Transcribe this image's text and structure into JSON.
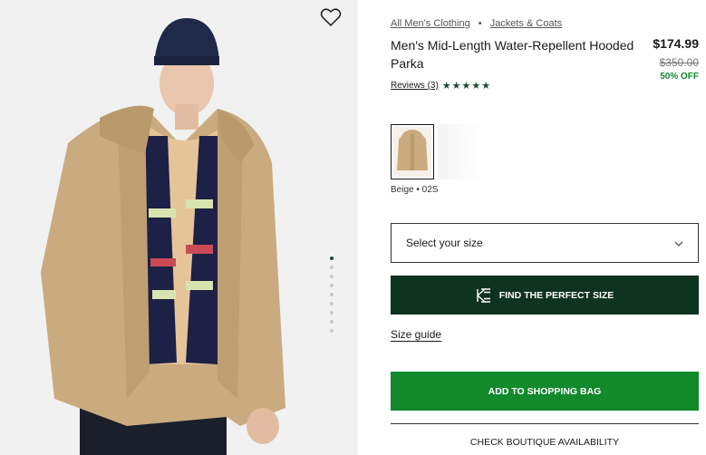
{
  "gallery": {
    "image_alt": "Model wearing beige mid-length hooded parka",
    "dot_count": 9,
    "active_dot": 0
  },
  "icons": {
    "wishlist": "heart-outline-icon",
    "stars": "star-icon",
    "chevron": "chevron-down-icon",
    "measure": "measure-logo-icon"
  },
  "product": {
    "breadcrumb": [
      "All Men's Clothing",
      "Jackets & Coats"
    ],
    "breadcrumb_separator": "•",
    "title": "Men's Mid-Length Water-Repellent Hooded Parka",
    "price_now": "$174.99",
    "price_was": "$350.00",
    "discount": "50% OFF",
    "reviews_label": "Reviews (3)",
    "stars": "★★★★★"
  },
  "colors": {
    "selected_label": "Beige • 02S",
    "accent_dark": "#0f3321",
    "accent_green": "#12892b",
    "beige": "#c9ab7f"
  },
  "actions": {
    "size_placeholder": "Select your size",
    "perfect_size_label": "FIND THE PERFECT SIZE",
    "size_guide_label": "Size guide",
    "add_to_bag_label": "ADD TO SHOPPING BAG",
    "boutique_label": "CHECK BOUTIQUE AVAILABILITY"
  }
}
